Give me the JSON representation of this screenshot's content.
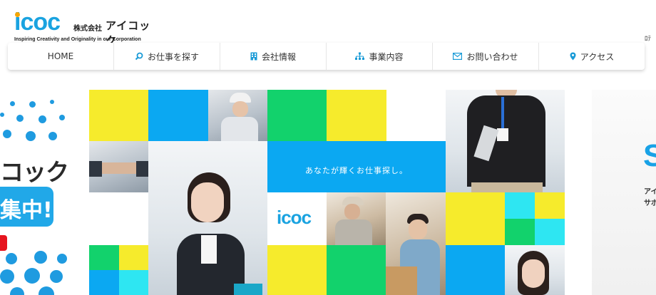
{
  "header": {
    "logo_text": "icoc",
    "company_prefix": "株式会社",
    "company_name": "アイコック",
    "tagline": "Inspiring Creativity and Originality in our Corporation",
    "corner_text": "ﾛﾃ"
  },
  "nav": {
    "items": [
      {
        "label": "HOME",
        "icon": ""
      },
      {
        "label": "お仕事を探す",
        "icon": "search-icon"
      },
      {
        "label": "会社情報",
        "icon": "building-icon"
      },
      {
        "label": "事業内容",
        "icon": "org-chart-icon"
      },
      {
        "label": "お問い合わせ",
        "icon": "mail-icon"
      },
      {
        "label": "アクセス",
        "icon": "map-pin-icon"
      }
    ]
  },
  "left_banner": {
    "title_fragment": "コック",
    "pill_fragment": "集中!"
  },
  "slide": {
    "catch_copy": "あなたが輝くお仕事探し。",
    "logo_text": "icoc"
  },
  "right_banner": {
    "big_fragment": "S",
    "line1": "アイ",
    "line2": "サポ"
  },
  "colors": {
    "brand_blue": "#1aa3e0",
    "tile_yellow": "#f6eb2c",
    "tile_blue": "#0ba8f2",
    "tile_green": "#12d26c",
    "tile_cyan": "#2ee6f2",
    "banner_red": "#e6141e"
  }
}
